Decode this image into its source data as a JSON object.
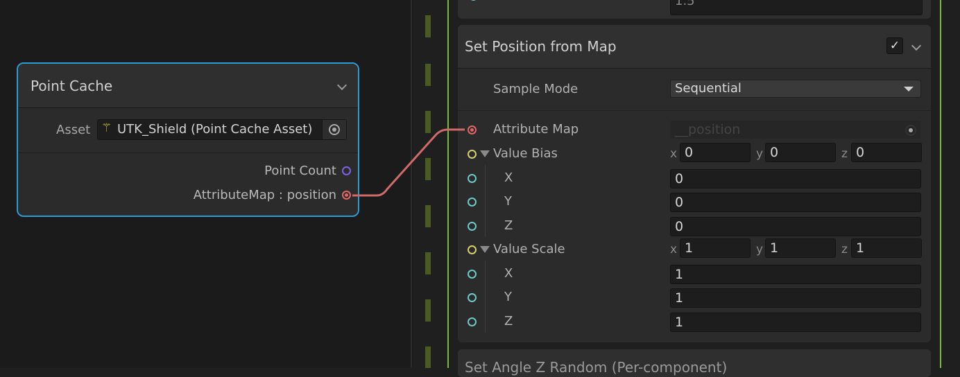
{
  "point_cache": {
    "title": "Point Cache",
    "asset_label": "Asset",
    "asset_value": "UTK_Shield (Point Cache Asset)",
    "outputs": [
      "Point Count",
      "AttributeMap : position"
    ]
  },
  "previous_block": {
    "value": "1.5"
  },
  "block": {
    "title": "Set Position from Map",
    "enabled": true,
    "check_glyph": "✓",
    "sample_mode_label": "Sample Mode",
    "sample_mode_value": "Sequential",
    "attribute_map_label": "Attribute Map",
    "attribute_map_value": "__position",
    "value_bias_label": "Value Bias",
    "value_scale_label": "Value Scale",
    "axes": [
      "x",
      "y",
      "z"
    ],
    "sub_axes": [
      "X",
      "Y",
      "Z"
    ],
    "bias": [
      "0",
      "0",
      "0"
    ],
    "scale": [
      "1",
      "1",
      "1"
    ]
  },
  "next_block": {
    "title": "Set Angle Z Random (Per-component)"
  },
  "colors": {
    "selection": "#2f9ad8",
    "context_border": "#7bbb3c",
    "wire": "#d26a6a",
    "port_cyan": "#6fc9c9",
    "port_yellow": "#d8d06a",
    "port_purple": "#7e62e8"
  }
}
